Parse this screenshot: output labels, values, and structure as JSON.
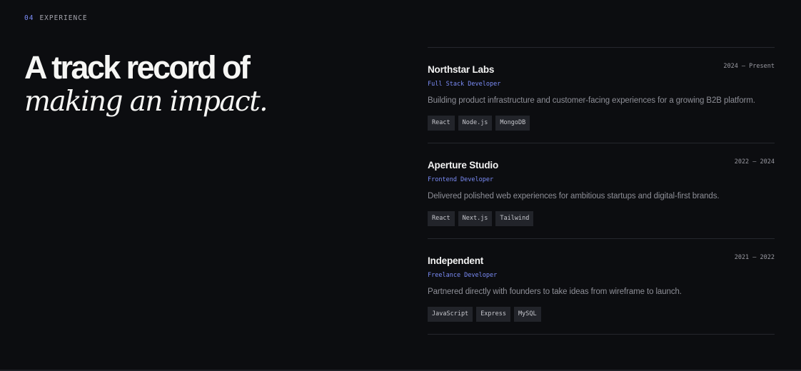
{
  "section": {
    "number": "04",
    "title": "EXPERIENCE"
  },
  "headline": {
    "line1": "A track record of",
    "line2": "making an impact."
  },
  "experience": [
    {
      "company": "Northstar Labs",
      "dates": "2024 — Present",
      "role": "Full Stack Developer",
      "description": "Building product infrastructure and customer-facing experiences for a growing B2B platform.",
      "tags": [
        "React",
        "Node.js",
        "MongoDB"
      ]
    },
    {
      "company": "Aperture Studio",
      "dates": "2022 — 2024",
      "role": "Frontend Developer",
      "description": "Delivered polished web experiences for ambitious startups and digital-first brands.",
      "tags": [
        "React",
        "Next.js",
        "Tailwind"
      ]
    },
    {
      "company": "Independent",
      "dates": "2021 — 2022",
      "role": "Freelance Developer",
      "description": "Partnered directly with founders to take ideas from wireframe to launch.",
      "tags": [
        "JavaScript",
        "Express",
        "MySQL"
      ]
    }
  ],
  "colors": {
    "background": "#0c0d10",
    "accent": "#7b8cf7",
    "tag_background": "#22242a",
    "divider": "#25272d"
  }
}
